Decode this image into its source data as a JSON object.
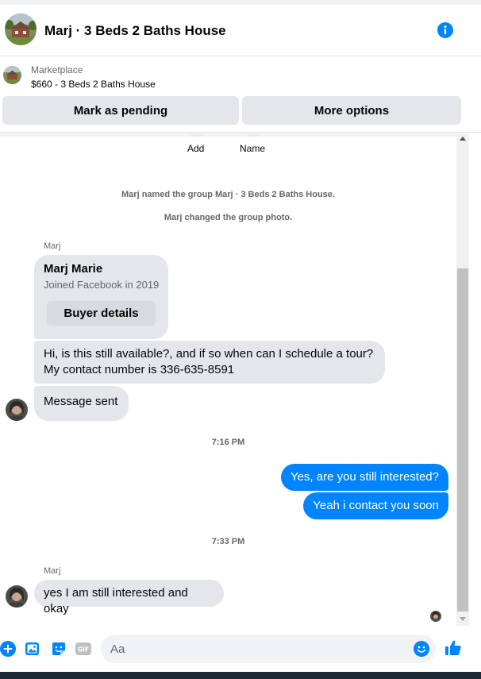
{
  "header": {
    "title": "Marj · 3 Beds 2 Baths House",
    "avatar_icon": "house-photo-icon",
    "info_icon": "info-icon"
  },
  "marketplace": {
    "label": "Marketplace",
    "item": "$660 - 3 Beds 2 Baths House",
    "pending_button": "Mark as pending",
    "more_button": "More options"
  },
  "conversation": {
    "add_label": "Add",
    "name_label": "Name",
    "system_messages": [
      "Marj named the group Marj · 3 Beds 2 Baths House.",
      "Marj changed the group photo."
    ],
    "sender_1": "Marj",
    "profile_card": {
      "name": "Marj Marie",
      "joined": "Joined Facebook in 2019",
      "button": "Buyer details"
    },
    "message_1_line1": "Hi, is this still available?, and if so when can I schedule a tour?",
    "message_1_line2": "My contact number is 336-635-8591",
    "message_2": "Message sent",
    "timestamp_1": "7:16 PM",
    "out_1": "Yes, are you still interested?",
    "out_2": "Yeah i contact you soon",
    "timestamp_2": "7:33 PM",
    "sender_2": "Marj",
    "message_3": "yes I am still interested and okay"
  },
  "composer": {
    "placeholder": "Aa",
    "icons": [
      "plus-icon",
      "photo-icon",
      "sticker-icon",
      "gif-icon",
      "emoji-icon",
      "thumbs-up-icon"
    ],
    "gif_text": "GIF"
  },
  "colors": {
    "accent": "#0084ff",
    "bubble_in": "#e4e6eb",
    "button_bg": "#e4e6eb",
    "meta_text": "#65676b"
  }
}
